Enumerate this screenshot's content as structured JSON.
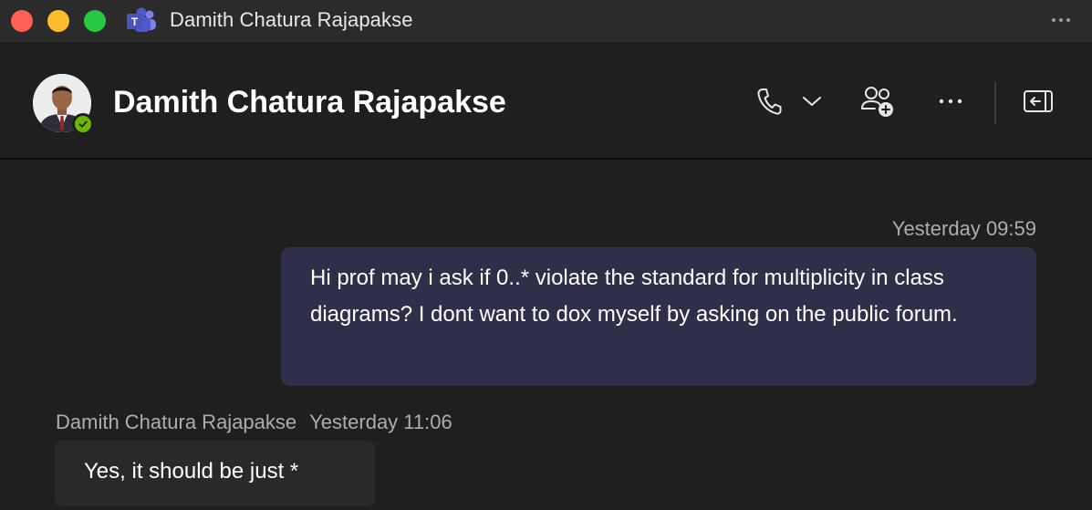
{
  "window": {
    "title": "Damith Chatura Rajapakse",
    "app_icon": "teams-icon"
  },
  "header": {
    "contact_name": "Damith Chatura Rajapakse",
    "presence": "available",
    "actions": [
      {
        "name": "call-button",
        "icon": "phone-icon"
      },
      {
        "name": "call-options-button",
        "icon": "chevron-down-icon"
      },
      {
        "name": "add-people-button",
        "icon": "add-people-icon"
      },
      {
        "name": "more-options-button",
        "icon": "more-horizontal-icon"
      },
      {
        "name": "pop-out-button",
        "icon": "pop-out-icon"
      }
    ]
  },
  "messages": [
    {
      "from": "me",
      "timestamp": "Yesterday 09:59",
      "text": "Hi prof may i ask if 0..* violate the standard for multiplicity in class diagrams? I dont want to dox myself by asking on the public forum."
    },
    {
      "from": "Damith Chatura Rajapakse",
      "timestamp": "Yesterday 11:06",
      "text": "Yes, it should be just *"
    }
  ],
  "colors": {
    "background": "#1f1f1f",
    "titlebar": "#2b2b2b",
    "my_bubble": "#2f2f4a",
    "their_bubble": "#292929",
    "presence_green": "#6bb700"
  }
}
